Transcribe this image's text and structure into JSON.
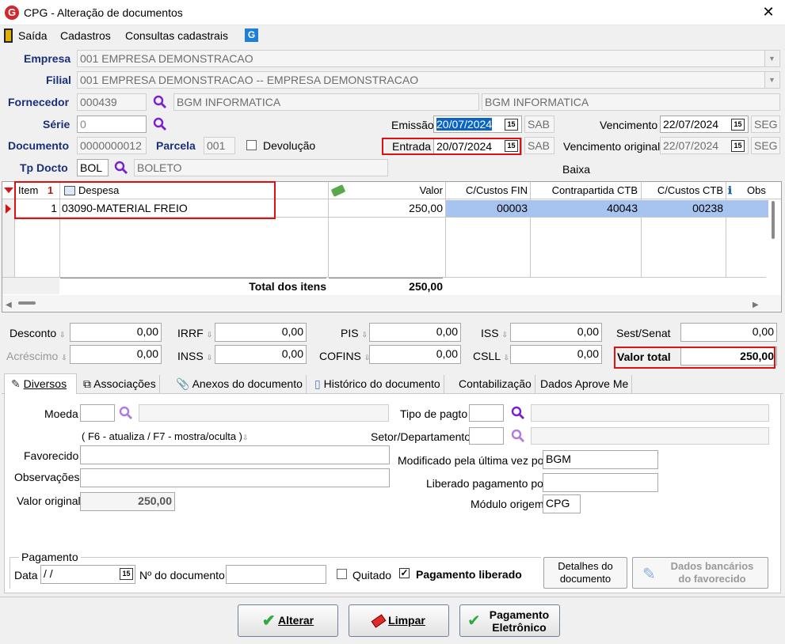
{
  "window": {
    "title": "CPG - Alteração de documentos",
    "close": "✕"
  },
  "menu": [
    "Saída",
    "Cadastros",
    "Consultas cadastrais"
  ],
  "labels": {
    "empresa": "Empresa",
    "filial": "Filial",
    "fornecedor": "Fornecedor",
    "serie": "Série",
    "documento": "Documento",
    "parcela": "Parcela",
    "devolucao": "Devolução",
    "tp_docto": "Tp Docto",
    "emissao": "Emissão",
    "entrada": "Entrada",
    "vencimento": "Vencimento",
    "vencimento_original": "Vencimento original",
    "baixa": "Baixa"
  },
  "fields": {
    "empresa": "001 EMPRESA DEMONSTRACAO",
    "filial": "001 EMPRESA DEMONSTRACAO -- EMPRESA DEMONSTRACAO",
    "fornecedor_code": "000439",
    "fornecedor_name": "BGM INFORMATICA",
    "fornecedor_name2": "BGM INFORMATICA",
    "serie": "0",
    "documento": "0000000012",
    "parcela": "001",
    "tp_docto_code": "BOL",
    "tp_docto_name": "BOLETO",
    "emissao": "20/07/2024",
    "emissao_day": "SAB",
    "entrada": "20/07/2024",
    "entrada_day": "SAB",
    "vencimento": "22/07/2024",
    "vencimento_day": "SEG",
    "vencimento_original": "22/07/2024",
    "vencimento_original_day": "SEG"
  },
  "grid": {
    "headers": {
      "item": "Item",
      "despesa": "Despesa",
      "valor": "Valor",
      "ccfin": "C/Custos FIN",
      "contrapartida": "Contrapartida CTB",
      "ccctb": "C/Custos CTB",
      "obs": "Obs"
    },
    "sort_mark": "1",
    "rows": [
      {
        "item": "1",
        "despesa": "03090-MATERIAL FREIO",
        "valor": "250,00",
        "ccfin": "00003",
        "contrapartida": "40043",
        "ccctb": "00238"
      }
    ],
    "total_label": "Total dos itens",
    "total_value": "250,00"
  },
  "totals": {
    "desconto_label": "Desconto",
    "desconto": "0,00",
    "acrescimo_label": "Acréscimo",
    "acrescimo": "0,00",
    "irrf_label": "IRRF",
    "irrf": "0,00",
    "inss_label": "INSS",
    "inss": "0,00",
    "pis_label": "PIS",
    "pis": "0,00",
    "cofins_label": "COFINS",
    "cofins": "0,00",
    "iss_label": "ISS",
    "iss": "0,00",
    "csll_label": "CSLL",
    "csll": "0,00",
    "sest_label": "Sest/Senat",
    "sest": "0,00",
    "valor_total_label": "Valor total",
    "valor_total": "250,00"
  },
  "tabs": [
    "Diversos",
    "Associações",
    "Anexos do documento",
    "Histórico do documento",
    "Contabilização",
    "Dados Aprove Me"
  ],
  "diversos": {
    "moeda_label": "Moeda",
    "hint": "( F6 - atualiza / F7 - mostra/oculta )",
    "favorecido_label": "Favorecido",
    "observacoes_label": "Observações",
    "valor_original_label": "Valor original",
    "valor_original": "250,00",
    "tipo_pagto_label": "Tipo de pagto",
    "setor_label": "Setor/Departamento",
    "modificado_label": "Modificado pela última vez por",
    "modificado": "BGM",
    "liberado_label": "Liberado pagamento por",
    "liberado": "",
    "modulo_label": "Módulo origem",
    "modulo": "CPG"
  },
  "pagamento": {
    "group": "Pagamento",
    "data_label": "Data",
    "data": " /  /",
    "ndoc_label": "Nº do documento",
    "quitado": "Quitado",
    "liberado": "Pagamento liberado",
    "detalhes_l1": "Detalhes do",
    "detalhes_l2": "documento",
    "bancarios_l1": "Dados bancários",
    "bancarios_l2": "do favorecido"
  },
  "buttons": {
    "alterar": "Alterar",
    "limpar": "Limpar",
    "pag_l1": "Pagamento",
    "pag_l2": "Eletrônico"
  },
  "colors": {
    "accent_red": "#d11111",
    "selection": "#0a64c8",
    "label_blue": "#1a2f7a"
  }
}
